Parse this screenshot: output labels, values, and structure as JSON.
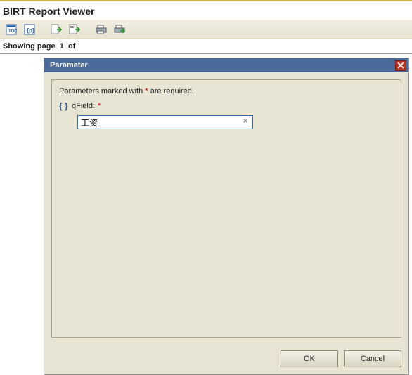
{
  "app": {
    "title": "BIRT Report Viewer"
  },
  "toolbar": {
    "icons": [
      "toc-icon",
      "params-icon",
      "export-data-icon",
      "export-report-icon",
      "print-icon",
      "print-server-icon"
    ]
  },
  "status": {
    "text_prefix": "Showing page",
    "page_number": "1",
    "text_suffix": "of"
  },
  "dialog": {
    "title": "Parameter",
    "required_note_prefix": "Parameters marked with ",
    "required_marker": "*",
    "required_note_suffix": " are required.",
    "field": {
      "label": "qField:",
      "required_marker": "*",
      "value": "工资"
    },
    "buttons": {
      "ok": "OK",
      "cancel": "Cancel"
    }
  }
}
